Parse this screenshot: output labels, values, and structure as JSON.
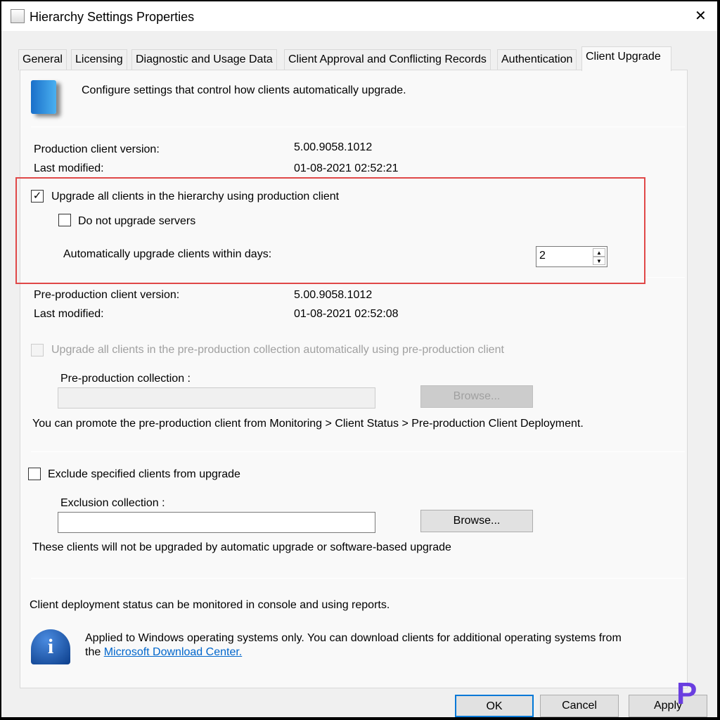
{
  "window": {
    "title": "Hierarchy Settings Properties"
  },
  "tabs": [
    {
      "label": "General"
    },
    {
      "label": "Licensing"
    },
    {
      "label": "Diagnostic and Usage Data"
    },
    {
      "label": "Client Approval and Conflicting Records"
    },
    {
      "label": "Authentication"
    },
    {
      "label": "Client Upgrade",
      "active": true
    }
  ],
  "header": {
    "text": "Configure settings that control how clients automatically upgrade."
  },
  "production": {
    "version_label": "Production client version:",
    "version": "5.00.9058.1012",
    "modified_label": "Last modified:",
    "modified": "01-08-2021 02:52:21",
    "upgrade_all_label": "Upgrade all clients in the hierarchy using production client",
    "upgrade_all_checked": true,
    "no_servers_label": "Do not upgrade servers",
    "no_servers_checked": false,
    "days_label": "Automatically upgrade clients within days:",
    "days_value": "2"
  },
  "preproduction": {
    "version_label": "Pre-production client version:",
    "version": "5.00.9058.1012",
    "modified_label": "Last modified:",
    "modified": "01-08-2021 02:52:08",
    "upgrade_label": "Upgrade all clients in the pre-production collection automatically using pre-production client",
    "collection_label": "Pre-production collection :",
    "browse_label": "Browse...",
    "promote_text": "You can promote the pre-production client from Monitoring > Client Status > Pre-production Client Deployment."
  },
  "exclusion": {
    "checkbox_label": "Exclude specified clients from upgrade",
    "collection_label": "Exclusion collection :",
    "browse_label": "Browse...",
    "note": "These clients will not be upgraded by automatic upgrade or software-based upgrade"
  },
  "footer": {
    "status_text": "Client deployment status can be monitored in console and using reports.",
    "info_text": "Applied to Windows operating systems only. You can download clients for additional operating systems from",
    "info_text2": "the",
    "link": "Microsoft Download Center."
  },
  "buttons": {
    "ok": "OK",
    "cancel": "Cancel",
    "apply": "Apply"
  },
  "colors": {
    "highlight": "#e04848",
    "accent": "#0078d7",
    "link": "#0066cc"
  }
}
